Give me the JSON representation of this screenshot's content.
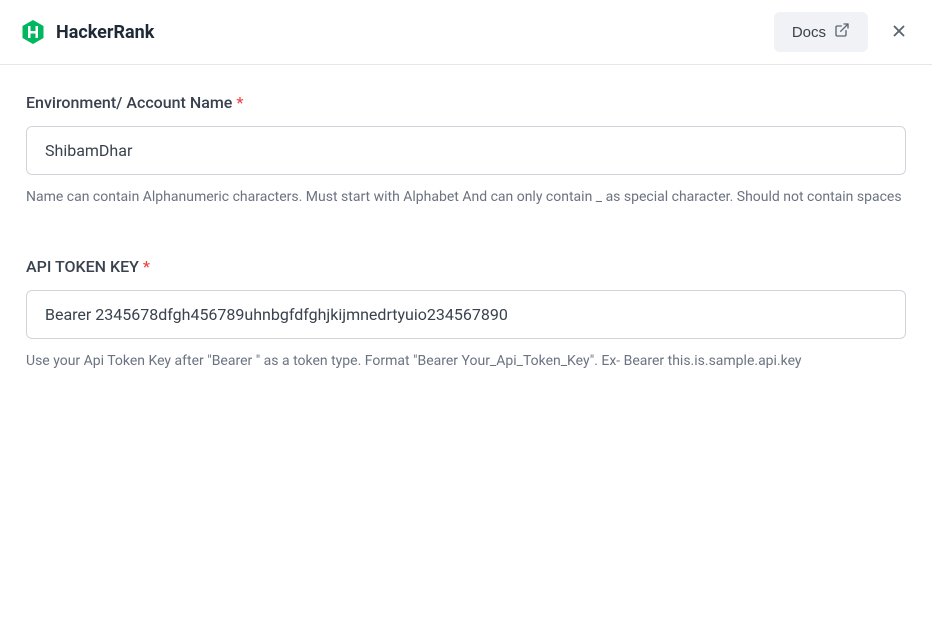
{
  "header": {
    "brand_name": "HackerRank",
    "docs_label": "Docs"
  },
  "form": {
    "env_name": {
      "label": "Environment/ Account Name",
      "value": "ShibamDhar",
      "helper": "Name can contain Alphanumeric characters. Must start with Alphabet And can only contain _ as special character. Should not contain spaces"
    },
    "api_token": {
      "label": "API TOKEN KEY",
      "value": "Bearer 2345678dfgh456789uhnbgfdfghjkijmnedrtyuio234567890",
      "helper": "Use your Api Token Key after \"Bearer \" as a token type. Format \"Bearer Your_Api_Token_Key\". Ex- Bearer this.is.sample.api.key"
    }
  },
  "colors": {
    "brand_green": "#00b760",
    "required_red": "#ef4444"
  }
}
